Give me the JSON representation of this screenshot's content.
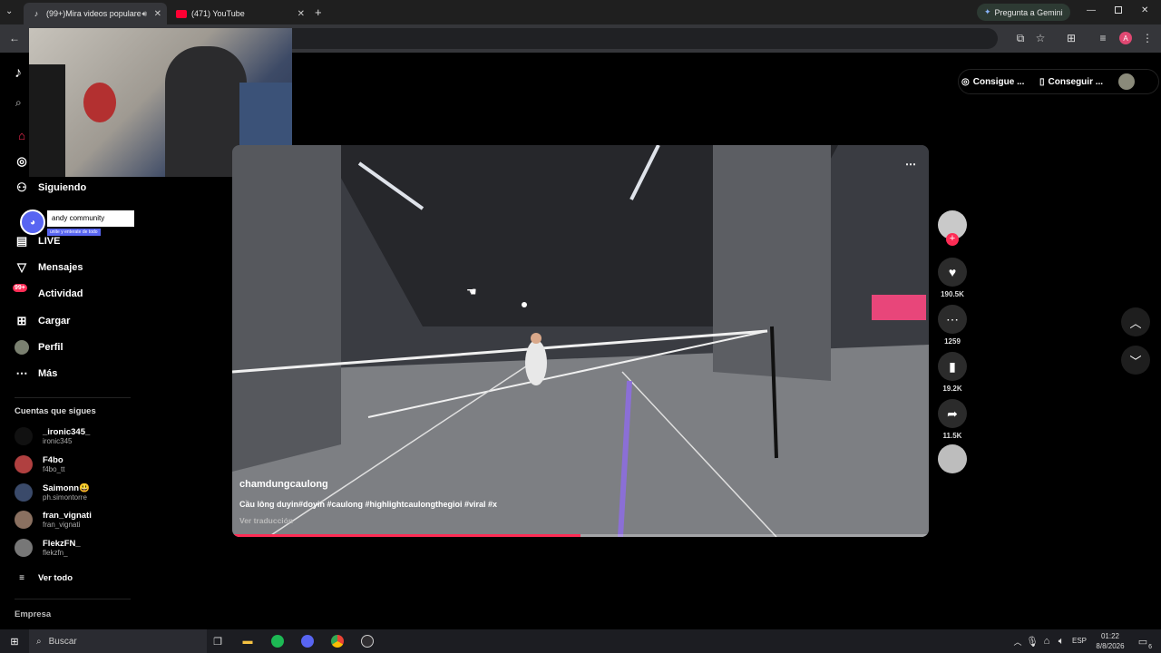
{
  "browser": {
    "tabs": [
      {
        "title": "(99+)Mira videos populares",
        "favicon": "tiktok-icon"
      },
      {
        "title": "(471) YouTube",
        "favicon": "youtube-icon"
      }
    ],
    "url_fragment": "/",
    "gemini_label": "Pregunta a Gemini",
    "profile_initial": "A"
  },
  "header": {
    "coins_label": "Consigue ...",
    "app_label": "Conseguir ..."
  },
  "sidebar": {
    "items": [
      {
        "label": "Siguiendo",
        "icon": "person-icon"
      },
      {
        "label": "LIVE",
        "icon": "live-icon"
      },
      {
        "label": "Mensajes",
        "icon": "send-icon"
      },
      {
        "label": "Actividad",
        "icon": "bell-icon",
        "badge": "99+"
      },
      {
        "label": "Cargar",
        "icon": "plus-box-icon"
      },
      {
        "label": "Perfil",
        "icon": "avatar"
      },
      {
        "label": "Más",
        "icon": "more-icon"
      }
    ],
    "following_title": "Cuentas que sigues",
    "following": [
      {
        "name": "_ironic345_",
        "handle": "ironic345"
      },
      {
        "name": "F4bo",
        "handle": "f4bo_tt"
      },
      {
        "name": "Saimonn😃",
        "handle": "ph.simontorre"
      },
      {
        "name": "fran_vignati",
        "handle": "fran_vignati"
      },
      {
        "name": "FlekzFN_",
        "handle": "flekzfn_"
      }
    ],
    "see_all": "Ver todo",
    "footer": "Empresa"
  },
  "overlay": {
    "discord_title": "andy community",
    "discord_sub": "unite y enterate de todo"
  },
  "video": {
    "author": "chamdungcaulong",
    "caption": "Cầu lông duyin#doyin #caulong #highlightcaulongthegioi #viral #x",
    "translate": "Ver traducción",
    "progress": 0.5
  },
  "actions": {
    "likes": "190.5K",
    "comments": "1259",
    "saves": "19.2K",
    "shares": "11.5K"
  },
  "taskbar": {
    "search": "Buscar",
    "lang": "ESP",
    "time": "01:22",
    "date": "8/8/2026",
    "notif": "6"
  },
  "colors": {
    "accent": "#fe2c55",
    "bg": "#000000"
  }
}
